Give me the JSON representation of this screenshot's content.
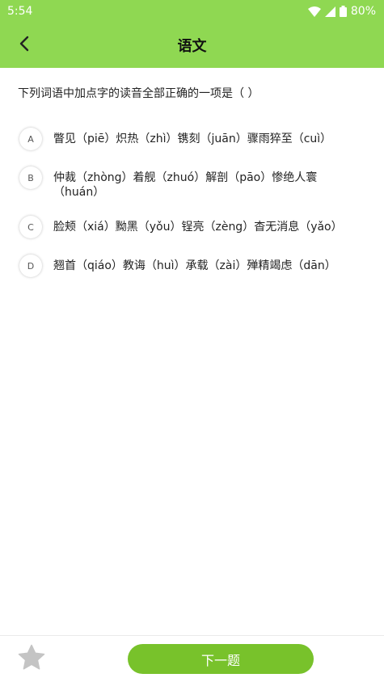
{
  "status_bar": {
    "time": "5:54",
    "battery": "80%",
    "icons": [
      "wifi-icon",
      "signal-icon",
      "battery-icon"
    ]
  },
  "header": {
    "title": "语文",
    "back_icon": "chevron-left-icon"
  },
  "question": {
    "text": "下列词语中加点字的读音全部正确的一项是（ ）"
  },
  "options": [
    {
      "letter": "A",
      "text": "瞥见（piē）炽热（zhì）镌刻（juān）骤雨猝至（cuì）"
    },
    {
      "letter": "B",
      "text": "仲裁（zhòng）着舰（zhuó）解剖（pāo）惨绝人寰（huán）"
    },
    {
      "letter": "C",
      "text": "脸颊（xiá）黝黑（yǒu）锃亮（zèng）杳无消息（yǎo）"
    },
    {
      "letter": "D",
      "text": "翘首（qiáo）教诲（huì）承载（zài）殚精竭虑（dān）"
    }
  ],
  "bottom_bar": {
    "favorite_icon": "star-icon",
    "next_label": "下一题"
  },
  "colors": {
    "header_bg": "#8fd852",
    "button_bg": "#78c22b",
    "star_gray": "#c4c4c4"
  }
}
